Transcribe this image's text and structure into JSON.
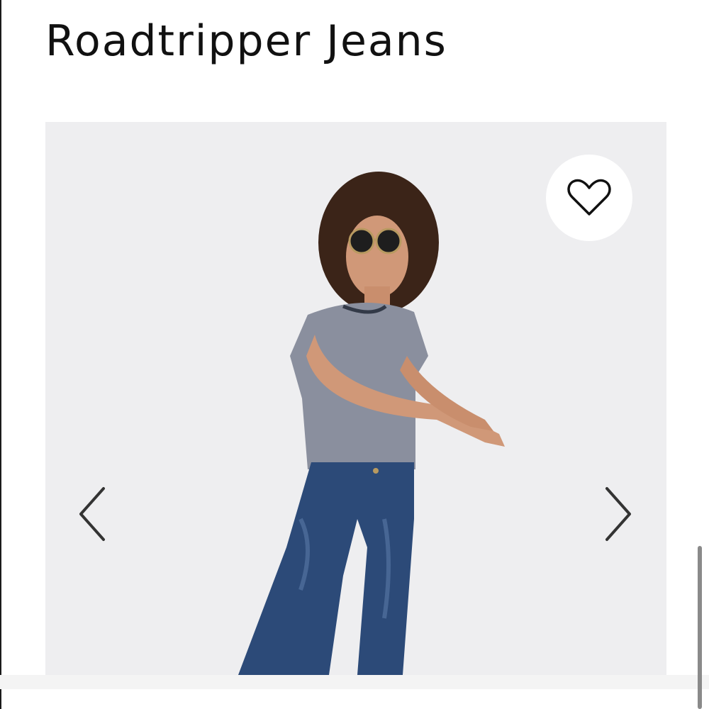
{
  "product": {
    "title": "Roadtripper Jeans"
  },
  "gallery": {
    "photo_alt": "Model wearing Roadtripper Jeans",
    "prev_icon": "chevron-left-icon",
    "next_icon": "chevron-right-icon",
    "favorite_icon": "heart-outline-icon"
  },
  "colors": {
    "text": "#111111",
    "gallery_background": "#eeeef0",
    "denim": "#2c4a78",
    "shirt": "#8a8f9e",
    "hair": "#3b2418",
    "skin": "#d09878",
    "icon_stroke": "#333333"
  }
}
